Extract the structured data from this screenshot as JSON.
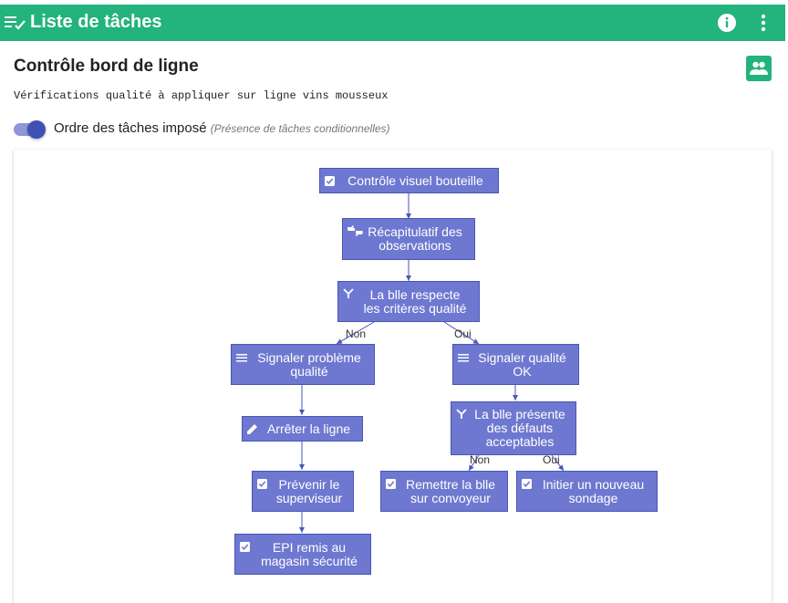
{
  "appbar": {
    "title": "Liste de tâches"
  },
  "header": {
    "title": "Contrôle bord de ligne",
    "description": "Vérifications qualité à appliquer sur ligne vins mousseux"
  },
  "toggle": {
    "label": "Ordre des tâches imposé",
    "hint": "(Présence de tâches conditionnelles)",
    "checked": true
  },
  "colors": {
    "appbar": "#23b37c",
    "node_fill": "#6e78d0",
    "node_border": "#4856b8",
    "toggle_thumb": "#3f51b5"
  },
  "flow": {
    "nodes": {
      "n1": {
        "text": "Contrôle visuel bouteille",
        "icon": "checkbox-icon"
      },
      "n2": {
        "line1": "Récapitulatif des",
        "line2": "observations",
        "icon": "thumbs-up-down-icon"
      },
      "n3": {
        "line1": "La blle respecte",
        "line2": "les critères qualité",
        "icon": "fork-icon"
      },
      "n4": {
        "line1": "Signaler problème",
        "line2": "qualité",
        "icon": "list-icon"
      },
      "n5": {
        "line1": "Signaler qualité",
        "line2": "OK",
        "icon": "list-icon"
      },
      "n6": {
        "text": "Arrêter la ligne",
        "icon": "pencil-icon"
      },
      "n7": {
        "line1": "La blle présente",
        "line2": "des défauts",
        "line3": "acceptables",
        "icon": "fork-icon"
      },
      "n8": {
        "line1": "Prévenir le",
        "line2": "superviseur",
        "icon": "checkbox-icon"
      },
      "n9": {
        "line1": "Remettre la blle",
        "line2": "sur convoyeur",
        "icon": "checkbox-icon"
      },
      "n10": {
        "line1": "Initier un nouveau",
        "line2": "sondage",
        "icon": "checkbox-icon"
      },
      "n11": {
        "line1": "EPI remis au",
        "line2": "magasin sécurité",
        "icon": "checkbox-icon"
      }
    },
    "edge_labels": {
      "no1": "Non",
      "yes1": "Oui",
      "no2": "Non",
      "yes2": "Oui"
    }
  }
}
